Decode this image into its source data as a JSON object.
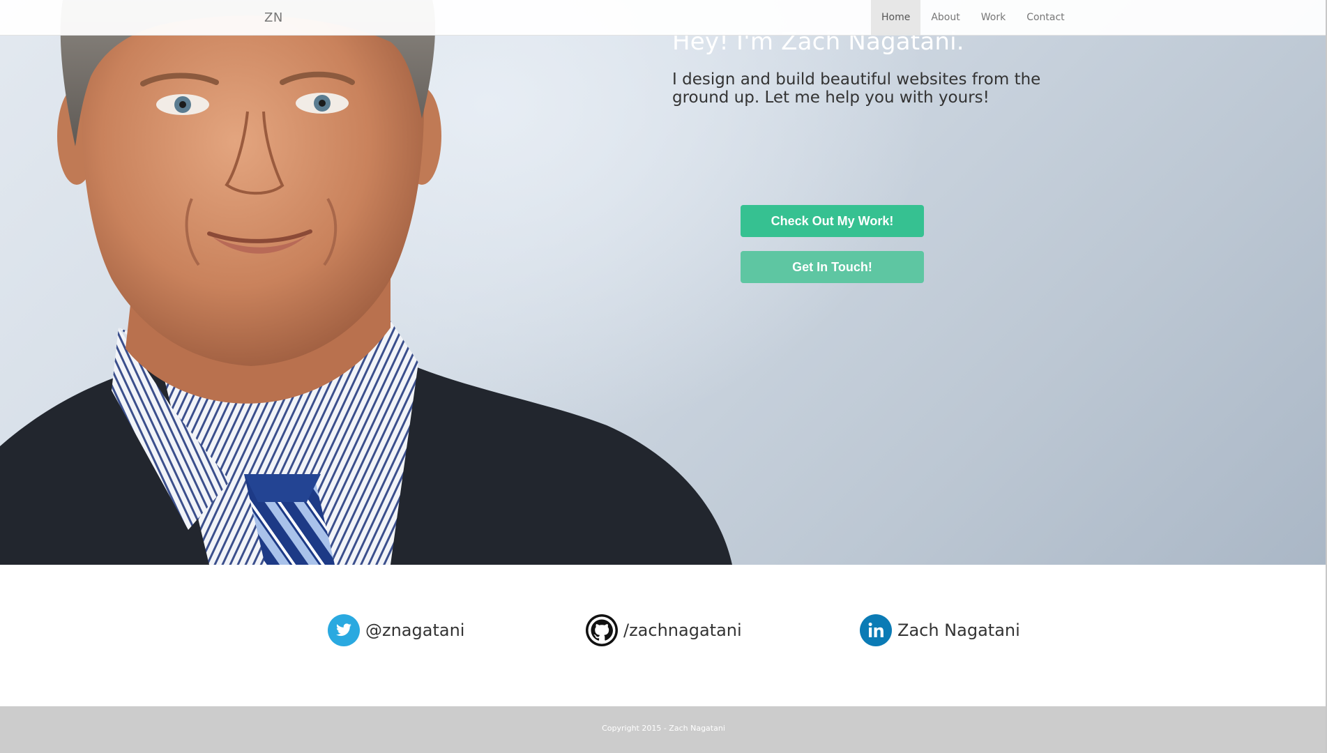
{
  "navbar": {
    "brand": "ZN",
    "items": [
      {
        "label": "Home",
        "active": true
      },
      {
        "label": "About",
        "active": false
      },
      {
        "label": "Work",
        "active": false
      },
      {
        "label": "Contact",
        "active": false
      }
    ]
  },
  "hero": {
    "title": "Hey! I'm Zach Nagatani.",
    "subtitle": "I design and build beautiful websites from the ground up. Let me help you with yours!",
    "buttons": {
      "work": "Check Out My Work!",
      "touch": "Get In Touch!"
    }
  },
  "social": {
    "twitter": {
      "label": "@znagatani",
      "icon": "twitter-icon"
    },
    "github": {
      "label": "/zachnagatani",
      "icon": "github-icon"
    },
    "linkedin": {
      "label": "Zach Nagatani",
      "icon": "linkedin-icon"
    }
  },
  "footer": {
    "copyright": "Copyright 2015 - Zach Nagatani"
  },
  "colors": {
    "accent": "#36c191",
    "accent_light": "#5ec6a2",
    "twitter": "#2aa9e0",
    "linkedin": "#0b7bb5",
    "footer_bg": "#cccccc"
  }
}
